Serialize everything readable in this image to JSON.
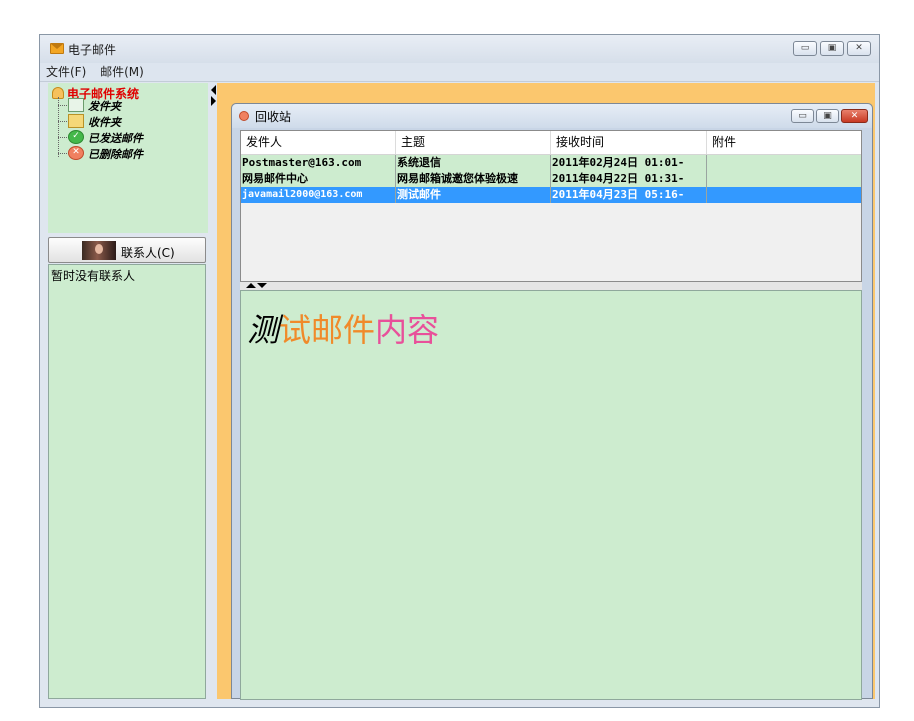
{
  "window": {
    "title": "电子邮件",
    "controls": {
      "minimize": "▭",
      "maximize": "▣",
      "close": "✕"
    }
  },
  "menu": {
    "items": [
      "文件(F)",
      "邮件(M)"
    ]
  },
  "tree": {
    "root": "电子邮件系统",
    "items": [
      {
        "label": "发件夹",
        "icon": "outbox-icon"
      },
      {
        "label": "收件夹",
        "icon": "inbox-icon"
      },
      {
        "label": "已发送邮件",
        "icon": "sent-check-icon"
      },
      {
        "label": "已删除邮件",
        "icon": "deleted-x-icon"
      }
    ]
  },
  "contacts": {
    "button_label": "联系人(C)",
    "empty_text": "暂时没有联系人"
  },
  "child_window": {
    "title": "回收站",
    "controls": {
      "minimize": "▭",
      "maximize": "▣",
      "close": "✕"
    }
  },
  "mail_list": {
    "columns": [
      "发件人",
      "主题",
      "接收时间",
      "附件"
    ],
    "rows": [
      {
        "sender": "Postmaster@163.com",
        "subject": "系统退信",
        "time": "2011年02月24日 01:01-",
        "attachment": "",
        "selected": false
      },
      {
        "sender": "网易邮件中心",
        "subject": "网易邮箱诚邀您体验极速",
        "time": "2011年04月22日 01:31-",
        "attachment": "",
        "selected": false
      },
      {
        "sender": "javamail2000@163.com",
        "subject": "测试邮件",
        "time": "2011年04月23日 05:16-",
        "attachment": "",
        "selected": true
      }
    ]
  },
  "reader": {
    "segments": [
      "测",
      "试邮件",
      "内容"
    ],
    "colors": [
      "#000000",
      "#f08a2a",
      "#e8509a"
    ]
  },
  "colors": {
    "mdi_background": "#fbc76e",
    "pane_green": "#cdeccf",
    "selection": "#3399ff",
    "tree_root": "#e00000"
  }
}
